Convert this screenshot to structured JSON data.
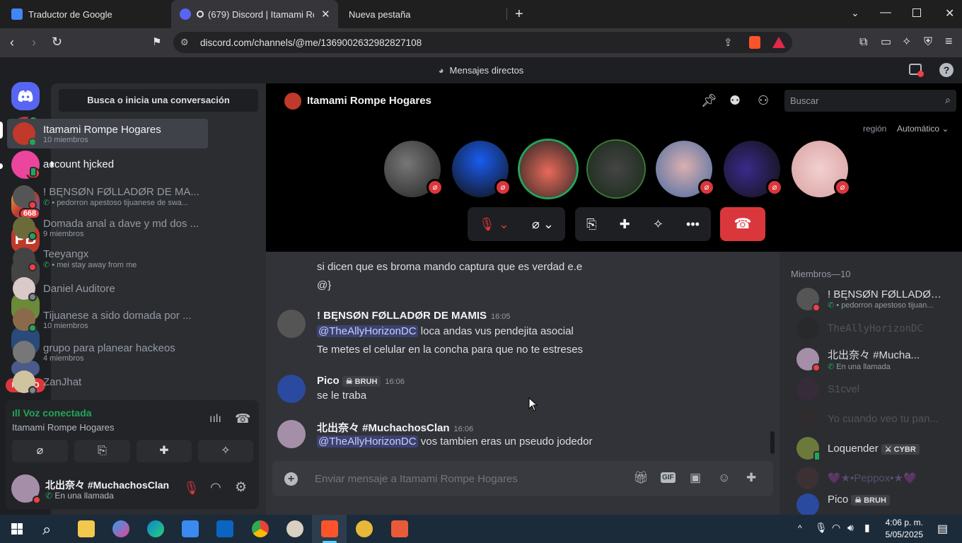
{
  "browser": {
    "tabs": [
      {
        "title": "Traductor de Google",
        "active": false
      },
      {
        "title": "(679) Discord | Itamami Rom",
        "active": true
      },
      {
        "title": "Nueva pestaña",
        "active": false
      }
    ],
    "url": "discord.com/channels/@me/1369002632982827108"
  },
  "discord": {
    "top_title": "Mensajes directos",
    "search_conv": "Busca o inicia una conversación",
    "guild_badges": {
      "dm": "3",
      "server": "668"
    },
    "new_badge": "NUEVO",
    "dms": [
      {
        "name": "Itamami Rompe Hogares",
        "sub": "10 miembros",
        "color": "#c0392b",
        "active": true
      },
      {
        "name": "account hjcked",
        "sub": "",
        "color": "#eb459e"
      },
      {
        "name": "! BĘNSØN FØLLADØR DE MA...",
        "sub": "• pedorron apestoso tijuanese de swa...",
        "color": "#555"
      },
      {
        "name": "Domada anal a dave y md dos ...",
        "sub": "9 miembros",
        "color": "#6b6b3a"
      },
      {
        "name": "Teeyangx",
        "sub": "• mei stay away from me",
        "color": "#444"
      },
      {
        "name": "Daniel Auditore",
        "sub": "",
        "color": "#d9c9c9"
      },
      {
        "name": "Tijuanese a sido domada por ...",
        "sub": "10 miembros",
        "color": "#8a6a4a"
      },
      {
        "name": "grupo para planear hackeos",
        "sub": "4 miembros",
        "color": "#777"
      },
      {
        "name": "ZanJhat",
        "sub": "",
        "color": "#cfc4a0"
      }
    ],
    "voice": {
      "status": "Voz conectada",
      "channel": "Itamami Rompe Hogares"
    },
    "user": {
      "name": "北出奈々 #MuchachosClan",
      "status": "En una llamada"
    },
    "channel": {
      "title": "Itamami Rompe Hogares",
      "search_placeholder": "Buscar",
      "region_label": "región",
      "region_value": "Automático"
    },
    "messages": [
      {
        "kind": "cont",
        "text": "si dicen que es broma mando captura que es verdad e.e"
      },
      {
        "kind": "cont",
        "text": "@}"
      },
      {
        "kind": "head",
        "author": "! BĘNSØN FØLLADØR DE MAMIS",
        "time": "16:05",
        "mention": "@TheAllyHorizonDC",
        "text": " loca andas vus pendejita asocial"
      },
      {
        "kind": "cont",
        "text": "Te metes el celular en la concha para que no te estreses"
      },
      {
        "kind": "head",
        "author": "Pico",
        "tag": "BRUH",
        "time": "16:06",
        "text": "se le traba"
      },
      {
        "kind": "head",
        "author": "北出奈々 #MuchachosClan",
        "time": "16:06",
        "mention": "@TheAllyHorizonDC",
        "text": " vos tambien eras un pseudo jodedor"
      }
    ],
    "composer_placeholder": "Enviar mensaje a Itamami Rompe Hogares",
    "members_header": "Miembros—10",
    "members": [
      {
        "name": "! BĘNSØN FØLLADØR...",
        "sub": "• pedorron apestoso tijuan...",
        "color": "#555",
        "dim": false
      },
      {
        "name": "TheAllyHorizonDC",
        "sub": "",
        "color": "#222",
        "dim": true
      },
      {
        "name": "北出奈々 #Mucha...",
        "sub": "En una llamada",
        "color": "#a58fa8",
        "dim": false
      },
      {
        "name": "S1cvel",
        "sub": "",
        "color": "#4a2a4a",
        "dim": true
      },
      {
        "name": "Yo cuando veo tu pan...",
        "sub": "",
        "color": "#3a2a2a",
        "dim": true
      },
      {
        "name": "Loquender",
        "tag": "CYBR",
        "sub": "",
        "color": "#6b7a3a",
        "dim": false
      },
      {
        "name": "💜★•Peppox•★💜",
        "sub": "",
        "color": "#5a3a3a",
        "dim": true
      },
      {
        "name": "Pico",
        "tag": "BRUH",
        "sub": "",
        "color": "#2a4aa0",
        "dim": false
      }
    ]
  },
  "taskbar": {
    "time": "4:06 p. m.",
    "date": "5/05/2025"
  },
  "colors": {
    "blurple": "#5865f2",
    "danger": "#da373c",
    "online": "#23a55a",
    "dnd": "#f23f43",
    "voice_green": "#23a55a"
  }
}
